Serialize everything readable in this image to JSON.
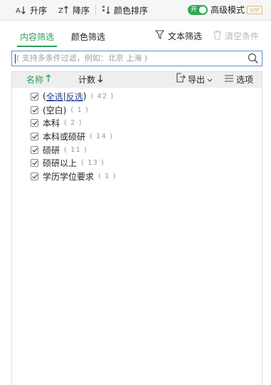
{
  "toolbar": {
    "sort_asc": "升序",
    "sort_desc": "降序",
    "color_sort": "颜色排序",
    "toggle_label": "开",
    "advanced_mode": "高级模式",
    "vip_badge": "VIP"
  },
  "tabs": [
    {
      "label": "内容筛选",
      "active": true
    },
    {
      "label": "颜色筛选",
      "active": false
    }
  ],
  "actions": {
    "text_filter": "文本筛选",
    "clear_conditions": "清空条件"
  },
  "search": {
    "placeholder": "( 支持多条件过滤，例如：北京  上海 )"
  },
  "list_header": {
    "name": "名称",
    "count": "计数",
    "export": "导出",
    "options": "选项"
  },
  "items": {
    "select_all_open": "(",
    "select_all": "全选",
    "select_sep": "|",
    "invert": "反选",
    "select_all_close": ")",
    "total": "( 42 )",
    "rows": [
      {
        "label": "(空白)",
        "count": "( 1 )"
      },
      {
        "label": "本科",
        "count": "( 2 )"
      },
      {
        "label": "本科或硕研",
        "count": "( 14 )"
      },
      {
        "label": "硕研",
        "count": "( 11 )"
      },
      {
        "label": "硕研以上",
        "count": "( 13 )"
      },
      {
        "label": "学历学位要求",
        "count": "( 1 )"
      }
    ]
  },
  "colors": {
    "accent_green": "#2f9e5a",
    "link_blue": "#1f3c9e",
    "search_border": "#5a8edb",
    "vip_gold": "#e6b87a"
  }
}
